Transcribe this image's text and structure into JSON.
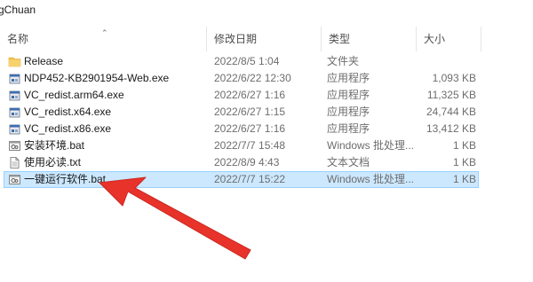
{
  "window": {
    "path_fragment": "gChuan"
  },
  "columns": {
    "name": "名称",
    "date": "修改日期",
    "type": "类型",
    "size": "大小"
  },
  "files": [
    {
      "name": "Release",
      "date": "2022/8/5 1:04",
      "type": "文件夹",
      "size": "",
      "icon": "folder-icon"
    },
    {
      "name": "NDP452-KB2901954-Web.exe",
      "date": "2022/6/22 12:30",
      "type": "应用程序",
      "size": "1,093 KB",
      "icon": "installer-icon"
    },
    {
      "name": "VC_redist.arm64.exe",
      "date": "2022/6/27 1:16",
      "type": "应用程序",
      "size": "11,325 KB",
      "icon": "installer-icon"
    },
    {
      "name": "VC_redist.x64.exe",
      "date": "2022/6/27 1:15",
      "type": "应用程序",
      "size": "24,744 KB",
      "icon": "installer-icon"
    },
    {
      "name": "VC_redist.x86.exe",
      "date": "2022/6/27 1:16",
      "type": "应用程序",
      "size": "13,412 KB",
      "icon": "installer-icon"
    },
    {
      "name": "安装环境.bat",
      "date": "2022/7/7 15:48",
      "type": "Windows 批处理...",
      "size": "1 KB",
      "icon": "batch-file-icon"
    },
    {
      "name": "使用必读.txt",
      "date": "2022/8/9 4:43",
      "type": "文本文档",
      "size": "1 KB",
      "icon": "text-file-icon"
    },
    {
      "name": "一键运行软件.bat",
      "date": "2022/7/7 15:22",
      "type": "Windows 批处理...",
      "size": "1 KB",
      "icon": "batch-file-icon",
      "selected": true
    }
  ],
  "colors": {
    "selection_bg": "#cce8ff",
    "selection_border": "#99d1ff",
    "annotation_arrow": "#e8332a",
    "folder": "#f2c14e"
  },
  "annotation": {
    "icon": "red-arrow-icon"
  }
}
